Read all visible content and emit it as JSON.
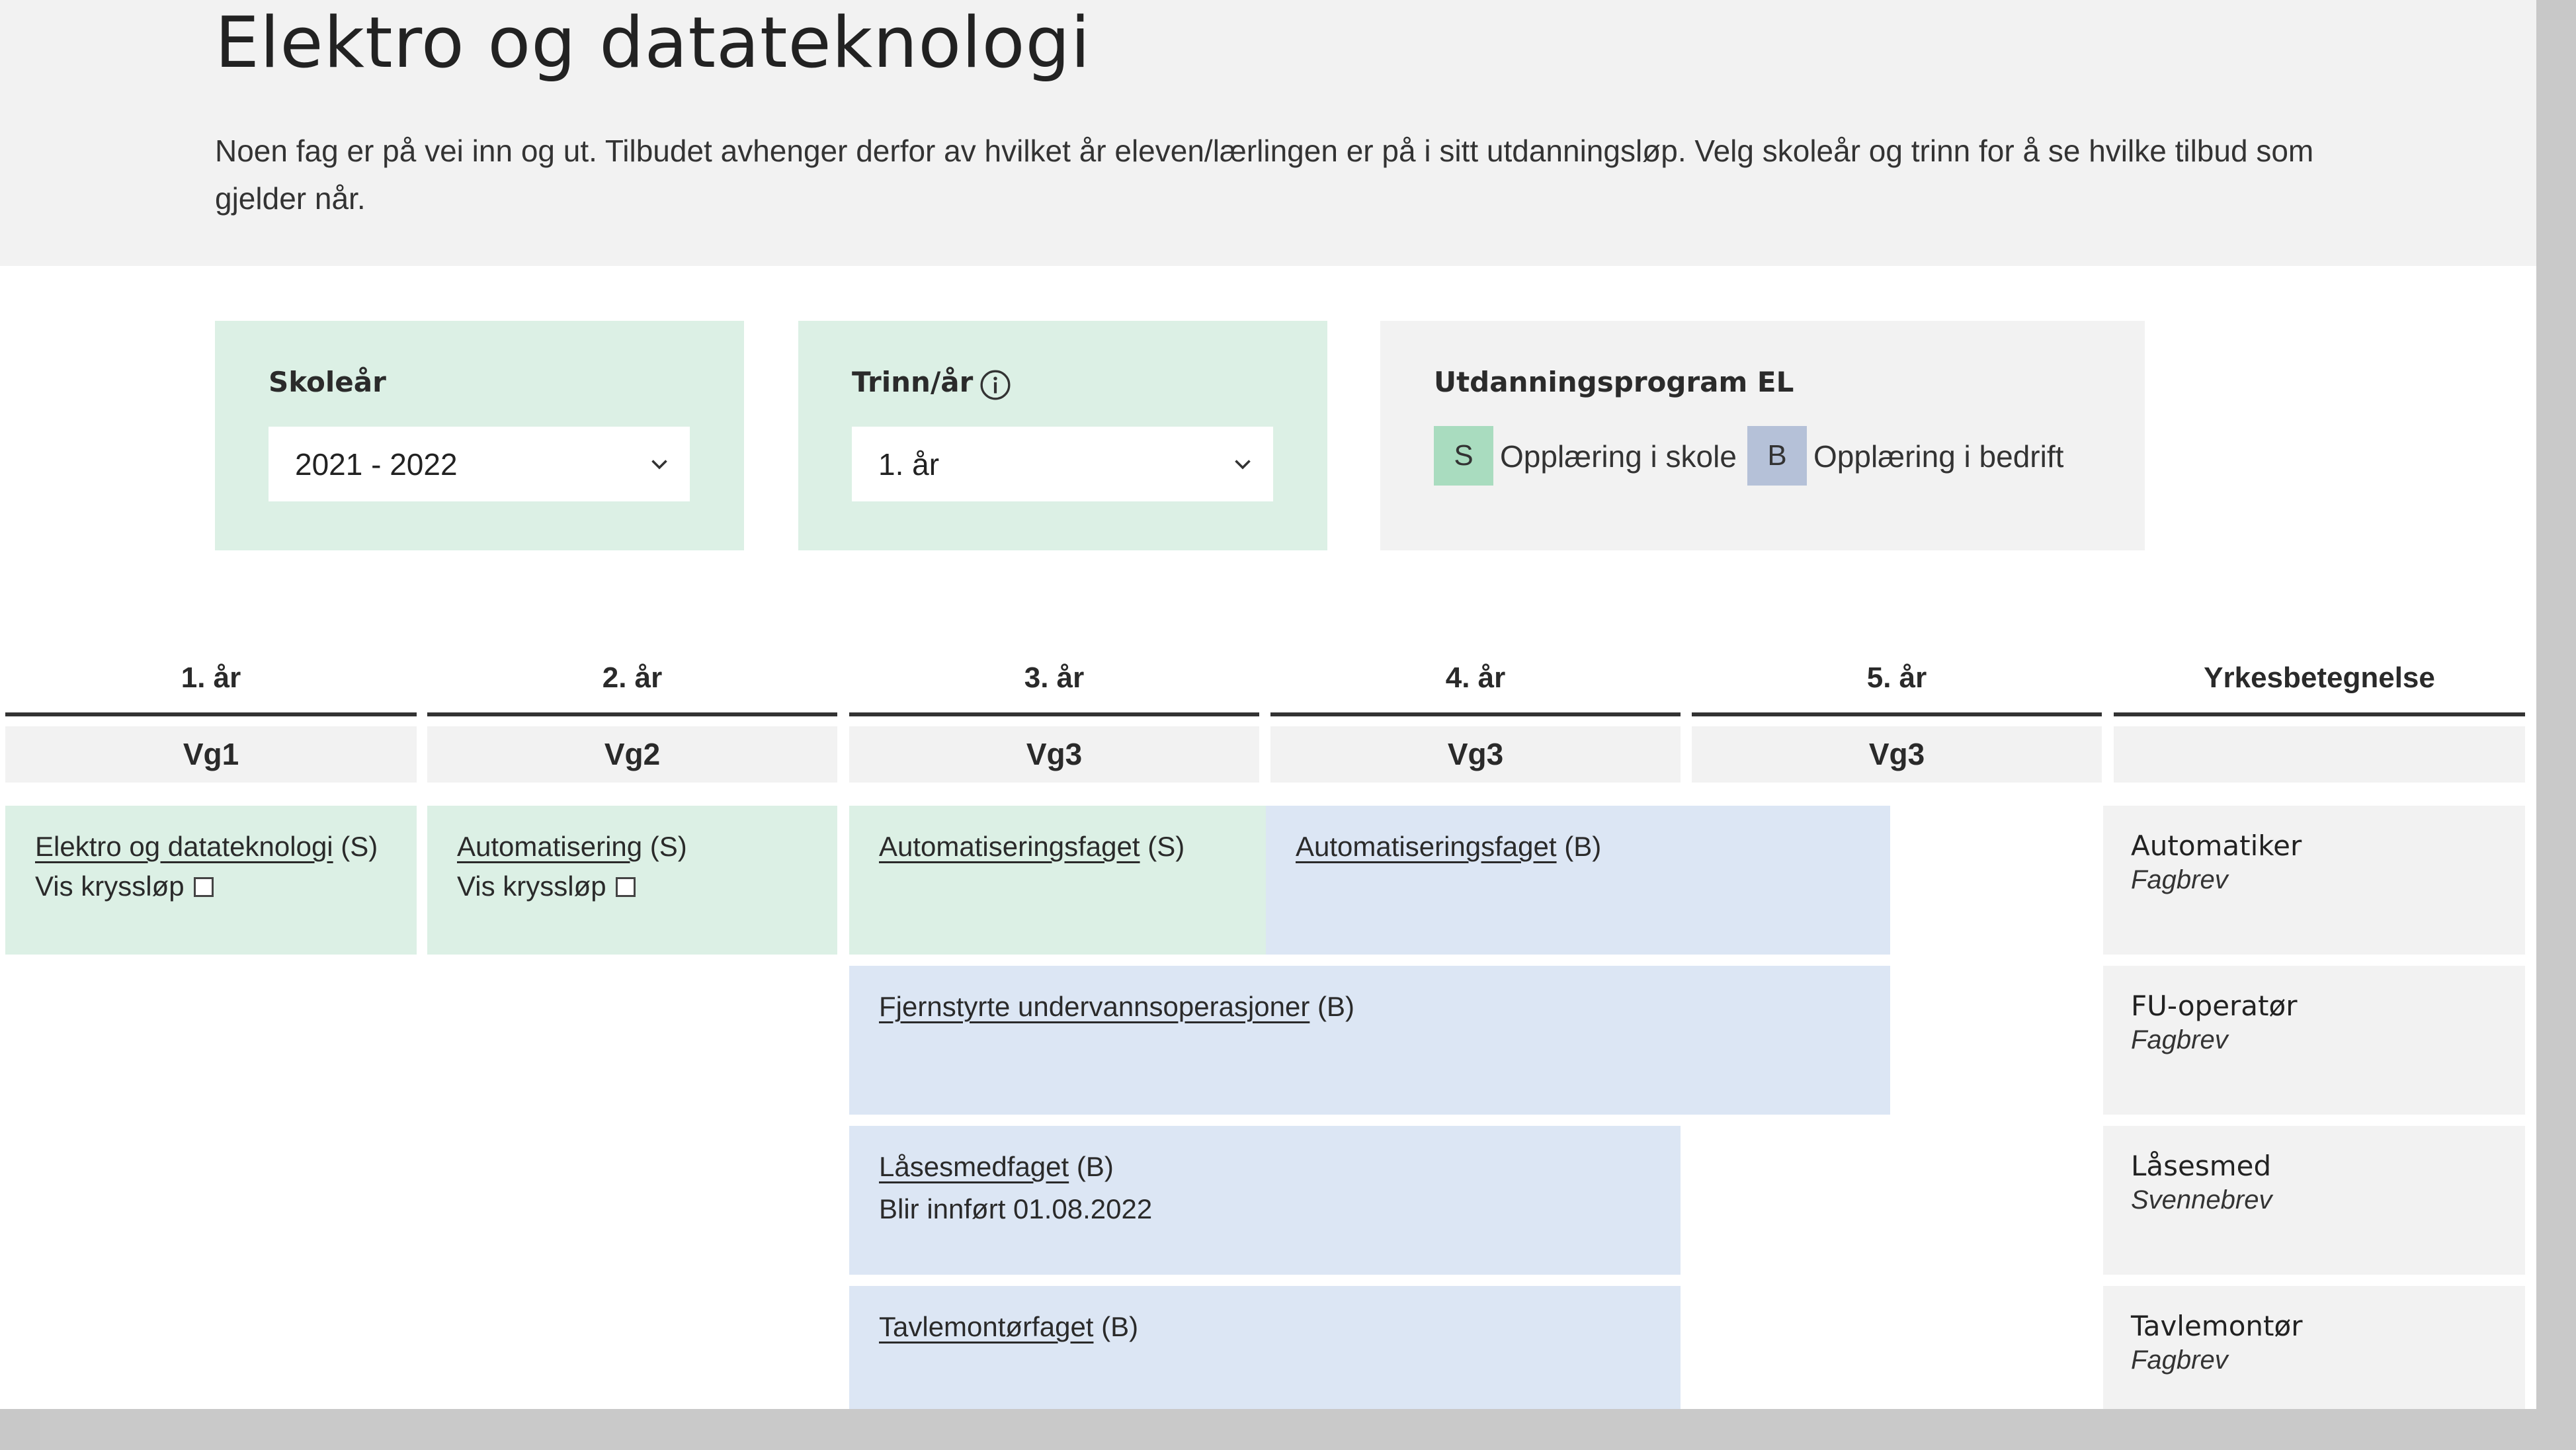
{
  "header": {
    "title": "Elektro og datateknologi",
    "intro": "Noen fag er på vei inn og ut. Tilbudet avhenger derfor av hvilket år eleven/lærlingen er på i sitt utdanningsløp. Velg skoleår og trinn for å se hvilke tilbud som gjelder når."
  },
  "filters": {
    "school_year": {
      "label": "Skoleår",
      "value": "2021 - 2022"
    },
    "step": {
      "label": "Trinn/år",
      "value": "1. år"
    },
    "legend": {
      "title": "Utdanningsprogram EL",
      "school_code": "S",
      "school_label": "Opplæring i skole",
      "company_code": "B",
      "company_label": "Opplæring i bedrift"
    },
    "colors": {
      "school": "#dcf0e5",
      "company": "#dce6f4",
      "legend_s": "#a9dcbf",
      "legend_b": "#b5c1d8"
    }
  },
  "table": {
    "columns": [
      {
        "year": "1. år",
        "level": "Vg1"
      },
      {
        "year": "2. år",
        "level": "Vg2"
      },
      {
        "year": "3. år",
        "level": "Vg3"
      },
      {
        "year": "4. år",
        "level": "Vg3"
      },
      {
        "year": "5. år",
        "level": "Vg3"
      },
      {
        "year": "Yrkesbetegnelse",
        "level": ""
      }
    ],
    "blocks": {
      "vg1": {
        "link": "Elektro og datateknologi",
        "suffix": " (S)",
        "sub": "Vis kryssløp"
      },
      "vg2": {
        "link": "Automatisering",
        "suffix": " (S)",
        "sub": "Vis kryssløp"
      },
      "auto_s": {
        "link": "Automatiseringsfaget",
        "suffix": " (S)"
      },
      "auto_b": {
        "link": "Automatiseringsfaget",
        "suffix": " (B)"
      },
      "fu": {
        "link": "Fjernstyrte undervannsoperasjoner",
        "suffix": " (B)"
      },
      "lase": {
        "link": "Låsesmedfaget",
        "suffix": " (B)",
        "sub": "Blir innført 01.08.2022"
      },
      "tavle": {
        "link": "Tavlemontørfaget",
        "suffix": " (B)"
      }
    },
    "professions": [
      {
        "name": "Automatiker",
        "type": "Fagbrev"
      },
      {
        "name": "FU-operatør",
        "type": "Fagbrev"
      },
      {
        "name": "Låsesmed",
        "type": "Svennebrev"
      },
      {
        "name": "Tavlemontør",
        "type": "Fagbrev"
      }
    ]
  },
  "icons": {
    "chevron": "chevron-down-icon",
    "info": "info-icon"
  }
}
